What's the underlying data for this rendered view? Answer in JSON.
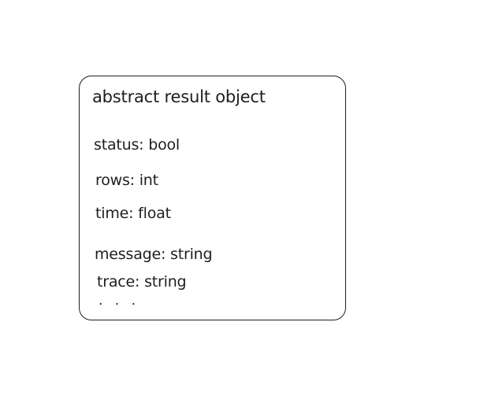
{
  "card": {
    "title": "abstract result object",
    "fields": [
      "status: bool",
      "rows: int",
      "time: float",
      "message: string",
      "trace: string"
    ],
    "ellipsis": ". . ."
  }
}
